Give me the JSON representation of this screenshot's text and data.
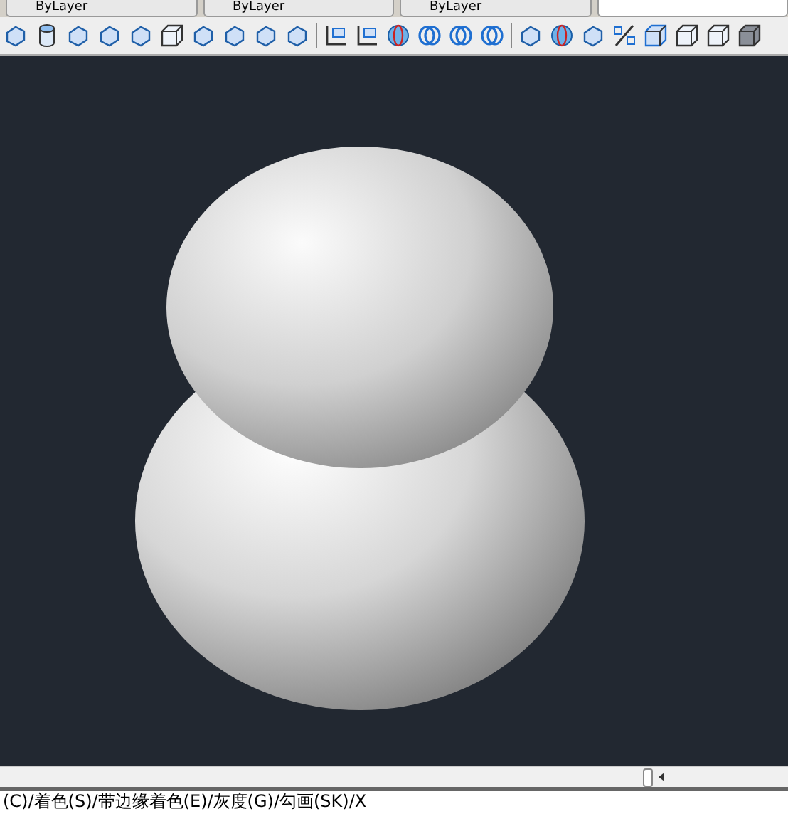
{
  "property_bar": {
    "dropdowns": [
      {
        "value": "ByLayer"
      },
      {
        "value": "ByLayer"
      },
      {
        "value": "ByLayer"
      }
    ]
  },
  "command_line": {
    "text": "(C)/着色(S)/带边缘着色(E)/灰度(G)/勾画(SK)/X"
  }
}
